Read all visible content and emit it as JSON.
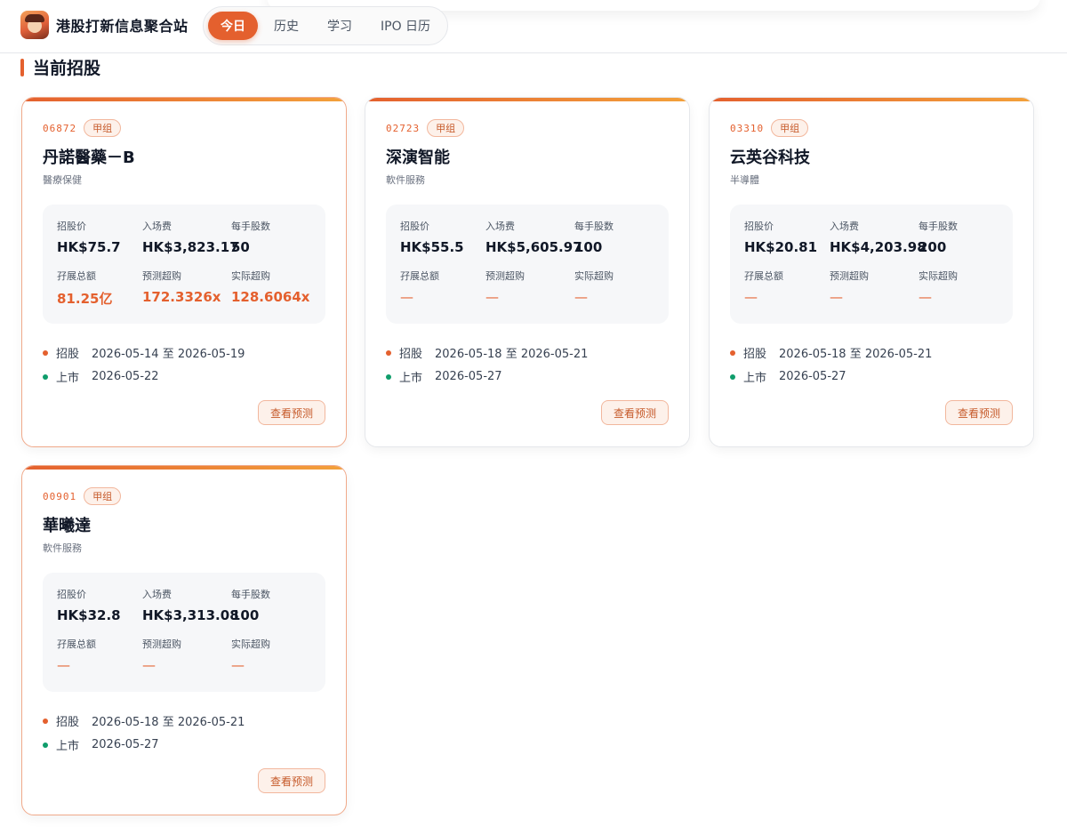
{
  "header": {
    "title": "港股打新信息聚合站",
    "tabs": [
      {
        "label": "今日",
        "active": true
      },
      {
        "label": "历史",
        "active": false
      },
      {
        "label": "学习",
        "active": false
      },
      {
        "label": "IPO 日历",
        "active": false
      }
    ]
  },
  "section": {
    "title": "当前招股"
  },
  "labels": {
    "price": "招股价",
    "entry_fee": "入场费",
    "lot_size": "每手股数",
    "margin_total": "孖展总额",
    "predicted_oversub": "预测超购",
    "actual_oversub": "实际超购",
    "subscription": "招股",
    "listing": "上市",
    "predict_button": "查看预测"
  },
  "colors": {
    "accent": "#e4602e",
    "listing_dot": "#0f9d6b"
  },
  "cards": [
    {
      "code": "06872",
      "group": "甲组",
      "name": "丹諾醫藥－B",
      "industry": "醫療保健",
      "price": "HK$75.7",
      "entry_fee": "HK$3,823.17",
      "lot_size": "50",
      "margin_total": "81.25亿",
      "predicted_oversub": "172.3326x",
      "actual_oversub": "128.6064x",
      "subscription_period": "2026-05-14 至 2026-05-19",
      "listing_date": "2026-05-22",
      "highlighted": true
    },
    {
      "code": "02723",
      "group": "甲组",
      "name": "深演智能",
      "industry": "軟件服務",
      "price": "HK$55.5",
      "entry_fee": "HK$5,605.97",
      "lot_size": "100",
      "margin_total": "—",
      "predicted_oversub": "—",
      "actual_oversub": "—",
      "subscription_period": "2026-05-18 至 2026-05-21",
      "listing_date": "2026-05-27",
      "highlighted": false
    },
    {
      "code": "03310",
      "group": "甲组",
      "name": "云英谷科技",
      "industry": "半導體",
      "price": "HK$20.81",
      "entry_fee": "HK$4,203.98",
      "lot_size": "200",
      "margin_total": "—",
      "predicted_oversub": "—",
      "actual_oversub": "—",
      "subscription_period": "2026-05-18 至 2026-05-21",
      "listing_date": "2026-05-27",
      "highlighted": false
    },
    {
      "code": "00901",
      "group": "甲组",
      "name": "華曦達",
      "industry": "軟件服務",
      "price": "HK$32.8",
      "entry_fee": "HK$3,313.08",
      "lot_size": "100",
      "margin_total": "—",
      "predicted_oversub": "—",
      "actual_oversub": "—",
      "subscription_period": "2026-05-18 至 2026-05-21",
      "listing_date": "2026-05-27",
      "highlighted": true
    }
  ]
}
